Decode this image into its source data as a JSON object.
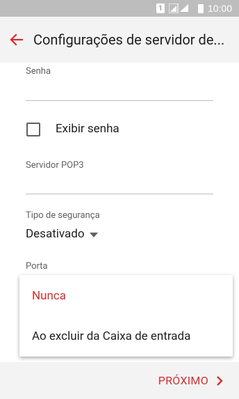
{
  "colors": {
    "accent": "#d32f2f",
    "status_bar_bg": "#bdbdbd",
    "app_bar_bg": "#f3f3f3",
    "bottom_bar_bg": "#f3f3f3",
    "divider": "#bdbdbd"
  },
  "status_bar": {
    "sim_label": "1",
    "time": "10:00",
    "icons": [
      "sim-icon",
      "signal-icon",
      "battery-icon"
    ]
  },
  "app_bar": {
    "back_icon": "back-arrow-icon",
    "title": "Configurações de servidor de..."
  },
  "form": {
    "password": {
      "label": "Senha",
      "value": ""
    },
    "show_password": {
      "label": "Exibir senha",
      "checked": false
    },
    "pop3_server": {
      "label": "Servidor POP3",
      "value": ""
    },
    "security_type": {
      "label": "Tipo de segurança",
      "value": "Desativado"
    },
    "port": {
      "label": "Porta"
    }
  },
  "popup_menu": {
    "items": [
      {
        "label": "Nunca",
        "selected": true
      },
      {
        "label": "Ao excluir da Caixa de entrada",
        "selected": false
      }
    ]
  },
  "bottom_bar": {
    "next_label": "PRÓXIMO",
    "next_icon": "chevron-right-icon"
  }
}
